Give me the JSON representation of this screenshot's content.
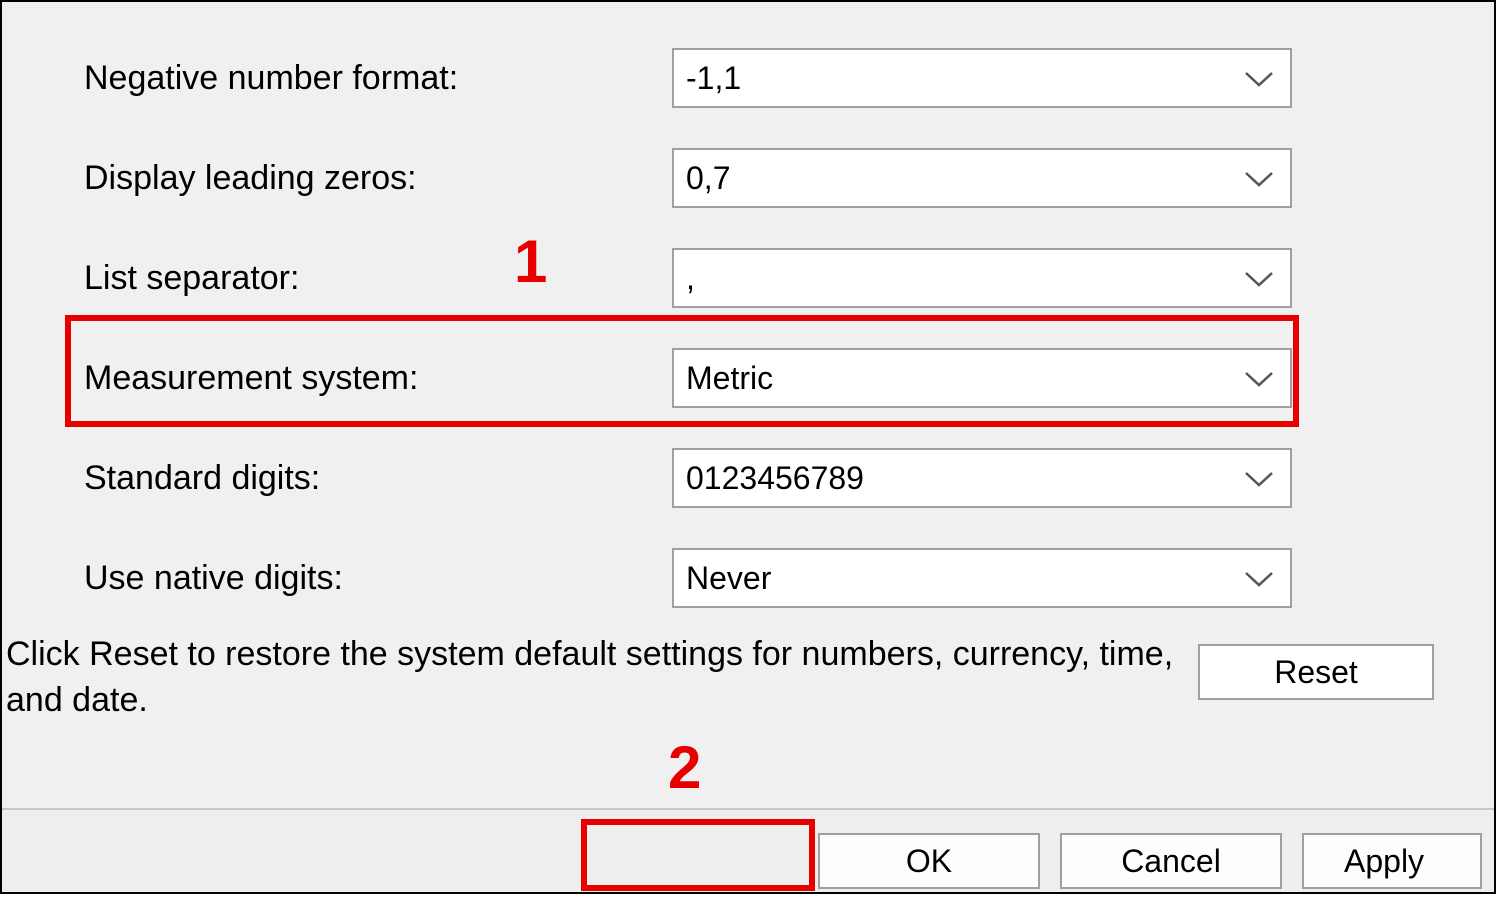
{
  "fields": {
    "negative_number_format": {
      "label": "Negative number format:",
      "value": "-1,1"
    },
    "display_leading_zeros": {
      "label": "Display leading zeros:",
      "value": "0,7"
    },
    "list_separator": {
      "label": "List separator:",
      "value": ","
    },
    "measurement_system": {
      "label": "Measurement system:",
      "value": "Metric"
    },
    "standard_digits": {
      "label": "Standard digits:",
      "value": "0123456789"
    },
    "use_native_digits": {
      "label": "Use native digits:",
      "value": "Never"
    }
  },
  "reset": {
    "text": "Click Reset to restore the system default settings for numbers, currency, time, and date.",
    "button": "Reset"
  },
  "buttons": {
    "ok": "OK",
    "cancel": "Cancel",
    "apply": "Apply"
  },
  "annotations": {
    "one": "1",
    "two": "2"
  },
  "colors": {
    "highlight": "#e60000"
  }
}
